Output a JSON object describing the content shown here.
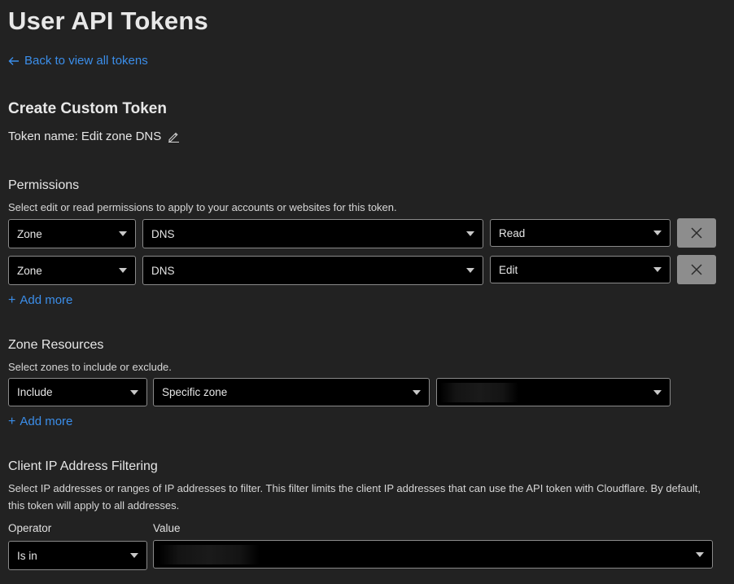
{
  "header": {
    "title": "User API Tokens",
    "back_link": "Back to view all tokens"
  },
  "create": {
    "title": "Create Custom Token",
    "token_name_label": "Token name:",
    "token_name_value": "Edit zone DNS"
  },
  "permissions": {
    "title": "Permissions",
    "description": "Select edit or read permissions to apply to your accounts or websites for this token.",
    "rows": [
      {
        "scope": "Zone",
        "resource": "DNS",
        "access": "Read"
      },
      {
        "scope": "Zone",
        "resource": "DNS",
        "access": "Edit"
      }
    ],
    "add_more": "Add more"
  },
  "zone_resources": {
    "title": "Zone Resources",
    "description": "Select zones to include or exclude.",
    "rows": [
      {
        "mode": "Include",
        "type": "Specific zone",
        "zone": ""
      }
    ],
    "add_more": "Add more"
  },
  "ip_filtering": {
    "title": "Client IP Address Filtering",
    "description": "Select IP addresses or ranges of IP addresses to filter. This filter limits the client IP addresses that can use the API token with Cloudflare. By default, this token will apply to all addresses.",
    "operator_label": "Operator",
    "value_label": "Value",
    "operator": "Is in",
    "value": ""
  },
  "colors": {
    "background": "#222222",
    "link": "#3b8eea",
    "field_bg": "#000000",
    "field_border": "#8a8a8a",
    "remove_button": "#8d8d8d"
  },
  "icons": {
    "back": "arrow-left-icon",
    "edit": "pencil-icon",
    "remove": "close-icon",
    "dropdown": "chevron-down-icon",
    "add": "plus-icon"
  }
}
